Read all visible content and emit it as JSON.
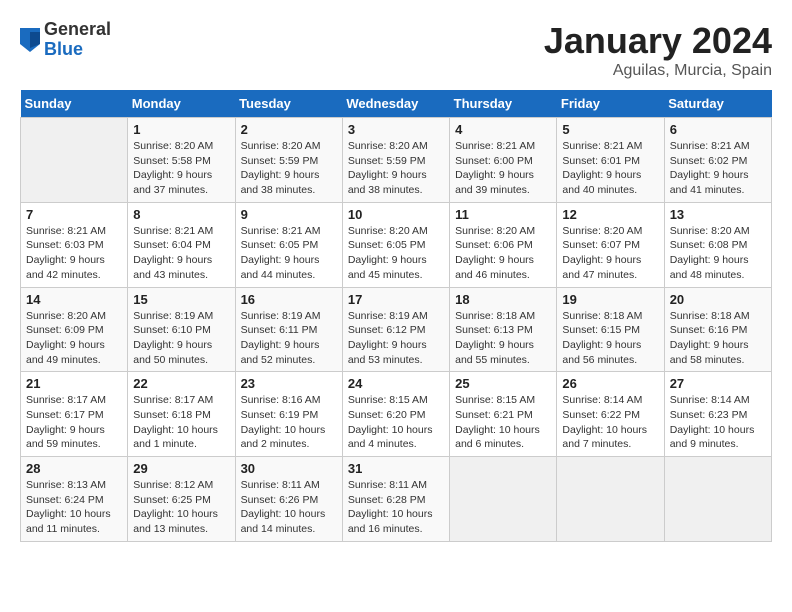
{
  "header": {
    "logo_general": "General",
    "logo_blue": "Blue",
    "title": "January 2024",
    "subtitle": "Aguilas, Murcia, Spain"
  },
  "days_of_week": [
    "Sunday",
    "Monday",
    "Tuesday",
    "Wednesday",
    "Thursday",
    "Friday",
    "Saturday"
  ],
  "weeks": [
    [
      {
        "day": "",
        "sunrise": "",
        "sunset": "",
        "daylight": ""
      },
      {
        "day": "1",
        "sunrise": "Sunrise: 8:20 AM",
        "sunset": "Sunset: 5:58 PM",
        "daylight": "Daylight: 9 hours and 37 minutes."
      },
      {
        "day": "2",
        "sunrise": "Sunrise: 8:20 AM",
        "sunset": "Sunset: 5:59 PM",
        "daylight": "Daylight: 9 hours and 38 minutes."
      },
      {
        "day": "3",
        "sunrise": "Sunrise: 8:20 AM",
        "sunset": "Sunset: 5:59 PM",
        "daylight": "Daylight: 9 hours and 38 minutes."
      },
      {
        "day": "4",
        "sunrise": "Sunrise: 8:21 AM",
        "sunset": "Sunset: 6:00 PM",
        "daylight": "Daylight: 9 hours and 39 minutes."
      },
      {
        "day": "5",
        "sunrise": "Sunrise: 8:21 AM",
        "sunset": "Sunset: 6:01 PM",
        "daylight": "Daylight: 9 hours and 40 minutes."
      },
      {
        "day": "6",
        "sunrise": "Sunrise: 8:21 AM",
        "sunset": "Sunset: 6:02 PM",
        "daylight": "Daylight: 9 hours and 41 minutes."
      }
    ],
    [
      {
        "day": "7",
        "sunrise": "Sunrise: 8:21 AM",
        "sunset": "Sunset: 6:03 PM",
        "daylight": "Daylight: 9 hours and 42 minutes."
      },
      {
        "day": "8",
        "sunrise": "Sunrise: 8:21 AM",
        "sunset": "Sunset: 6:04 PM",
        "daylight": "Daylight: 9 hours and 43 minutes."
      },
      {
        "day": "9",
        "sunrise": "Sunrise: 8:21 AM",
        "sunset": "Sunset: 6:05 PM",
        "daylight": "Daylight: 9 hours and 44 minutes."
      },
      {
        "day": "10",
        "sunrise": "Sunrise: 8:20 AM",
        "sunset": "Sunset: 6:05 PM",
        "daylight": "Daylight: 9 hours and 45 minutes."
      },
      {
        "day": "11",
        "sunrise": "Sunrise: 8:20 AM",
        "sunset": "Sunset: 6:06 PM",
        "daylight": "Daylight: 9 hours and 46 minutes."
      },
      {
        "day": "12",
        "sunrise": "Sunrise: 8:20 AM",
        "sunset": "Sunset: 6:07 PM",
        "daylight": "Daylight: 9 hours and 47 minutes."
      },
      {
        "day": "13",
        "sunrise": "Sunrise: 8:20 AM",
        "sunset": "Sunset: 6:08 PM",
        "daylight": "Daylight: 9 hours and 48 minutes."
      }
    ],
    [
      {
        "day": "14",
        "sunrise": "Sunrise: 8:20 AM",
        "sunset": "Sunset: 6:09 PM",
        "daylight": "Daylight: 9 hours and 49 minutes."
      },
      {
        "day": "15",
        "sunrise": "Sunrise: 8:19 AM",
        "sunset": "Sunset: 6:10 PM",
        "daylight": "Daylight: 9 hours and 50 minutes."
      },
      {
        "day": "16",
        "sunrise": "Sunrise: 8:19 AM",
        "sunset": "Sunset: 6:11 PM",
        "daylight": "Daylight: 9 hours and 52 minutes."
      },
      {
        "day": "17",
        "sunrise": "Sunrise: 8:19 AM",
        "sunset": "Sunset: 6:12 PM",
        "daylight": "Daylight: 9 hours and 53 minutes."
      },
      {
        "day": "18",
        "sunrise": "Sunrise: 8:18 AM",
        "sunset": "Sunset: 6:13 PM",
        "daylight": "Daylight: 9 hours and 55 minutes."
      },
      {
        "day": "19",
        "sunrise": "Sunrise: 8:18 AM",
        "sunset": "Sunset: 6:15 PM",
        "daylight": "Daylight: 9 hours and 56 minutes."
      },
      {
        "day": "20",
        "sunrise": "Sunrise: 8:18 AM",
        "sunset": "Sunset: 6:16 PM",
        "daylight": "Daylight: 9 hours and 58 minutes."
      }
    ],
    [
      {
        "day": "21",
        "sunrise": "Sunrise: 8:17 AM",
        "sunset": "Sunset: 6:17 PM",
        "daylight": "Daylight: 9 hours and 59 minutes."
      },
      {
        "day": "22",
        "sunrise": "Sunrise: 8:17 AM",
        "sunset": "Sunset: 6:18 PM",
        "daylight": "Daylight: 10 hours and 1 minute."
      },
      {
        "day": "23",
        "sunrise": "Sunrise: 8:16 AM",
        "sunset": "Sunset: 6:19 PM",
        "daylight": "Daylight: 10 hours and 2 minutes."
      },
      {
        "day": "24",
        "sunrise": "Sunrise: 8:15 AM",
        "sunset": "Sunset: 6:20 PM",
        "daylight": "Daylight: 10 hours and 4 minutes."
      },
      {
        "day": "25",
        "sunrise": "Sunrise: 8:15 AM",
        "sunset": "Sunset: 6:21 PM",
        "daylight": "Daylight: 10 hours and 6 minutes."
      },
      {
        "day": "26",
        "sunrise": "Sunrise: 8:14 AM",
        "sunset": "Sunset: 6:22 PM",
        "daylight": "Daylight: 10 hours and 7 minutes."
      },
      {
        "day": "27",
        "sunrise": "Sunrise: 8:14 AM",
        "sunset": "Sunset: 6:23 PM",
        "daylight": "Daylight: 10 hours and 9 minutes."
      }
    ],
    [
      {
        "day": "28",
        "sunrise": "Sunrise: 8:13 AM",
        "sunset": "Sunset: 6:24 PM",
        "daylight": "Daylight: 10 hours and 11 minutes."
      },
      {
        "day": "29",
        "sunrise": "Sunrise: 8:12 AM",
        "sunset": "Sunset: 6:25 PM",
        "daylight": "Daylight: 10 hours and 13 minutes."
      },
      {
        "day": "30",
        "sunrise": "Sunrise: 8:11 AM",
        "sunset": "Sunset: 6:26 PM",
        "daylight": "Daylight: 10 hours and 14 minutes."
      },
      {
        "day": "31",
        "sunrise": "Sunrise: 8:11 AM",
        "sunset": "Sunset: 6:28 PM",
        "daylight": "Daylight: 10 hours and 16 minutes."
      },
      {
        "day": "",
        "sunrise": "",
        "sunset": "",
        "daylight": ""
      },
      {
        "day": "",
        "sunrise": "",
        "sunset": "",
        "daylight": ""
      },
      {
        "day": "",
        "sunrise": "",
        "sunset": "",
        "daylight": ""
      }
    ]
  ]
}
